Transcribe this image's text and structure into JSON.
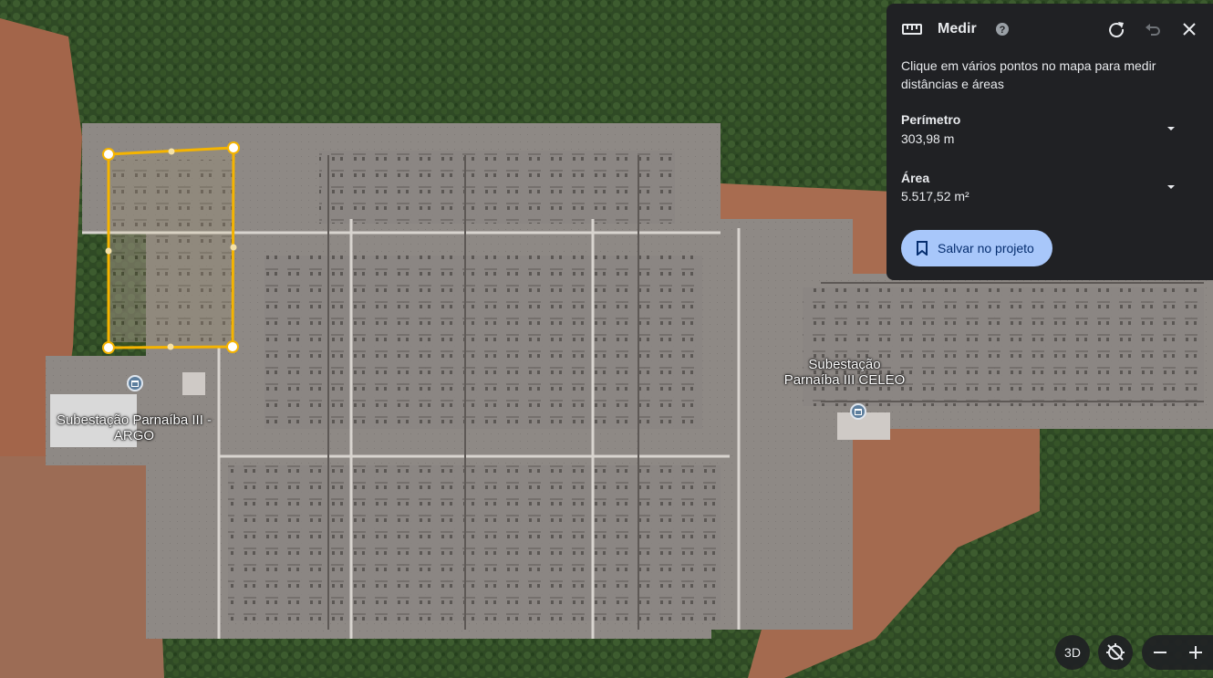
{
  "colors": {
    "panel_bg": "#202124",
    "accent": "#a8c7fa",
    "measure": "#f5b400"
  },
  "map": {
    "places": [
      {
        "id": "argo",
        "name": "Subestação Parnaíba III - ARGO"
      },
      {
        "id": "celeo",
        "name": "Subestação Parnaíba III CELEO"
      }
    ],
    "icons": [
      "place-pin-icon"
    ]
  },
  "measure_panel": {
    "title": "Medir",
    "hint": "Clique em vários pontos no mapa para medir distâncias e áreas",
    "perimeter_label": "Perímetro",
    "perimeter_value": "303,98 m",
    "area_label": "Área",
    "area_value": "5.517,52 m²",
    "save_label": "Salvar no projeto",
    "icons": [
      "ruler-icon",
      "help-icon",
      "redo-icon",
      "undo-icon",
      "close-icon",
      "chevron-down-icon",
      "bookmark-icon"
    ]
  },
  "controls": {
    "view_3d_label": "3D",
    "icons": [
      "compass-reset-icon",
      "zoom-out-icon",
      "zoom-in-icon"
    ]
  }
}
